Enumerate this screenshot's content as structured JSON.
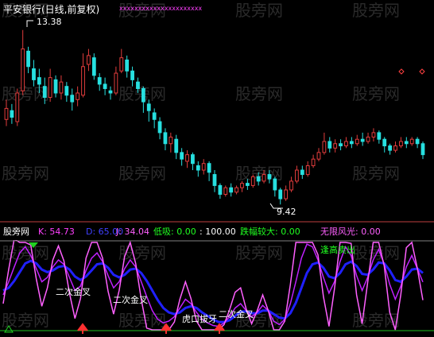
{
  "title": "平安银行(日线,前复权)",
  "watermark": "股旁网",
  "colors": {
    "background": "#000000",
    "up_candle": "#e03c3c",
    "down_candle": "#27e0e0",
    "title_text": "#ffffff",
    "k_line": "#ff40ff",
    "d_line": "#2020ff",
    "j_line": "#ff60ff",
    "diff_line": "#2a8bff",
    "baseline": "#20c020",
    "k_text": "#ff40ff",
    "d_text": "#4040ff",
    "j_text": "#ff60ff",
    "green_text": "#20ff20",
    "white_text": "#ffffff",
    "top_marks": "#ff40ff",
    "up_arrow": "#ff3030",
    "green_arrow": "#20d020"
  },
  "price_panel": {
    "high_label": "13.38",
    "low_label": "9.42",
    "top_marks": "xxxxxxxxxxxxxxxxxxxxxx"
  },
  "indicator_header": {
    "name": "股旁网",
    "k": "K: 54.73",
    "d": "D: 65.00",
    "j": "J: 34.04",
    "dixi": "低吸: 0.00",
    "level": ": 100.00",
    "diefu": "跌幅较大: 0.00",
    "wuxian": "无限风光: 0.00"
  },
  "annotations": {
    "ercijinchai1": "二次金叉",
    "ercijinchai2": "二次金叉",
    "ercijinchai3": "二次金叉",
    "hukoubayao": "虎口拔牙",
    "fenggaomaichu": "逢高卖出"
  },
  "chart_data": {
    "type": "candlestick",
    "title": "平安银行(日线,前复权)",
    "price_range": [
      9.1,
      13.7
    ],
    "high": 13.38,
    "low": 9.42,
    "candles": [
      [
        11.35,
        11.6,
        11.8,
        11.2
      ],
      [
        11.55,
        11.4,
        11.7,
        11.25
      ],
      [
        11.3,
        11.95,
        12.05,
        11.2
      ],
      [
        12.0,
        12.95,
        13.38,
        11.9
      ],
      [
        12.9,
        12.55,
        13.0,
        12.4
      ],
      [
        12.5,
        12.25,
        12.7,
        12.1
      ],
      [
        12.3,
        12.15,
        12.5,
        11.95
      ],
      [
        12.1,
        11.85,
        12.3,
        11.7
      ],
      [
        11.85,
        12.3,
        12.5,
        11.75
      ],
      [
        12.25,
        11.95,
        12.35,
        11.85
      ],
      [
        11.95,
        12.2,
        12.35,
        11.8
      ],
      [
        12.1,
        11.9,
        12.2,
        11.75
      ],
      [
        11.9,
        11.75,
        12.05,
        11.55
      ],
      [
        11.8,
        11.95,
        12.1,
        11.65
      ],
      [
        11.9,
        12.55,
        12.85,
        11.85
      ],
      [
        12.6,
        12.8,
        12.95,
        12.45
      ],
      [
        12.75,
        12.35,
        12.85,
        12.25
      ],
      [
        12.3,
        12.15,
        12.4,
        12.0
      ],
      [
        12.15,
        12.05,
        12.3,
        11.9
      ],
      [
        12.0,
        11.95,
        12.1,
        11.8
      ],
      [
        11.95,
        12.4,
        12.55,
        11.9
      ],
      [
        12.45,
        12.75,
        12.95,
        12.4
      ],
      [
        12.7,
        12.45,
        12.8,
        12.3
      ],
      [
        12.45,
        12.25,
        12.55,
        12.1
      ],
      [
        12.2,
        12.05,
        12.3,
        11.95
      ],
      [
        12.05,
        11.75,
        12.1,
        11.5
      ],
      [
        11.7,
        11.55,
        11.8,
        11.3
      ],
      [
        11.5,
        11.35,
        11.6,
        11.15
      ],
      [
        11.3,
        11.05,
        11.4,
        10.9
      ],
      [
        11.05,
        10.8,
        11.15,
        10.65
      ],
      [
        10.8,
        10.95,
        11.05,
        10.6
      ],
      [
        10.9,
        10.6,
        11.0,
        10.45
      ],
      [
        10.6,
        10.45,
        10.7,
        10.3
      ],
      [
        10.4,
        10.55,
        10.65,
        10.25
      ],
      [
        10.55,
        10.35,
        10.6,
        10.2
      ],
      [
        10.3,
        10.2,
        10.4,
        10.05
      ],
      [
        10.2,
        10.35,
        10.45,
        10.1
      ],
      [
        10.35,
        10.15,
        10.4,
        9.95
      ],
      [
        10.1,
        9.85,
        10.2,
        9.7
      ],
      [
        9.85,
        9.65,
        9.9,
        9.55
      ],
      [
        9.65,
        9.8,
        9.85,
        9.6
      ],
      [
        9.8,
        9.7,
        9.9,
        9.6
      ],
      [
        9.7,
        9.8,
        9.85,
        9.65
      ],
      [
        9.8,
        9.9,
        9.95,
        9.7
      ],
      [
        9.9,
        9.85,
        10.0,
        9.75
      ],
      [
        9.85,
        10.05,
        10.1,
        9.8
      ],
      [
        10.05,
        9.95,
        10.15,
        9.85
      ],
      [
        9.95,
        10.1,
        10.2,
        9.9
      ],
      [
        10.1,
        10.0,
        10.2,
        9.9
      ],
      [
        10.0,
        9.75,
        10.05,
        9.6
      ],
      [
        9.75,
        9.55,
        9.8,
        9.42
      ],
      [
        9.55,
        9.75,
        9.85,
        9.5
      ],
      [
        9.75,
        9.95,
        10.05,
        9.7
      ],
      [
        9.95,
        10.2,
        10.3,
        9.9
      ],
      [
        10.2,
        10.1,
        10.3,
        10.0
      ],
      [
        10.1,
        10.3,
        10.4,
        10.05
      ],
      [
        10.3,
        10.45,
        10.55,
        10.25
      ],
      [
        10.45,
        10.6,
        10.7,
        10.4
      ],
      [
        10.6,
        10.85,
        11.05,
        10.55
      ],
      [
        10.85,
        10.7,
        10.95,
        10.6
      ],
      [
        10.7,
        10.8,
        10.9,
        10.6
      ],
      [
        10.8,
        10.75,
        10.9,
        10.65
      ],
      [
        10.75,
        10.85,
        10.95,
        10.7
      ],
      [
        10.85,
        10.8,
        10.95,
        10.7
      ],
      [
        10.8,
        10.9,
        11.0,
        10.75
      ],
      [
        10.9,
        10.85,
        11.05,
        10.75
      ],
      [
        10.85,
        10.95,
        11.05,
        10.8
      ],
      [
        10.95,
        11.05,
        11.15,
        10.85
      ],
      [
        11.05,
        10.9,
        11.1,
        10.8
      ],
      [
        10.9,
        10.75,
        10.95,
        10.6
      ],
      [
        10.75,
        10.65,
        10.8,
        10.55
      ],
      [
        10.65,
        10.75,
        10.85,
        10.6
      ],
      [
        10.75,
        10.85,
        10.95,
        10.7
      ],
      [
        10.85,
        10.8,
        10.95,
        10.7
      ],
      [
        10.8,
        10.9,
        10.95,
        10.75
      ],
      [
        10.9,
        10.8,
        10.95,
        10.7
      ],
      [
        10.8,
        10.55,
        10.85,
        10.45
      ]
    ],
    "indicator": {
      "name": "股旁网",
      "range": [
        0,
        100
      ],
      "K": [
        40,
        55,
        72,
        88,
        95,
        85,
        70,
        55,
        60,
        72,
        80,
        75,
        60,
        45,
        50,
        68,
        82,
        88,
        78,
        62,
        48,
        55,
        70,
        80,
        72,
        55,
        38,
        22,
        12,
        8,
        10,
        15,
        25,
        35,
        30,
        20,
        12,
        8,
        5,
        4,
        8,
        15,
        25,
        30,
        22,
        15,
        20,
        28,
        22,
        10,
        6,
        12,
        30,
        55,
        82,
        98,
        95,
        80,
        60,
        42,
        55,
        78,
        95,
        85,
        62,
        45,
        60,
        80,
        92,
        75,
        52,
        35,
        50,
        72,
        85,
        70,
        54.73
      ],
      "D": [
        45,
        48,
        56,
        66,
        76,
        79,
        76,
        69,
        66,
        68,
        72,
        73,
        69,
        61,
        57,
        61,
        68,
        75,
        76,
        71,
        63,
        60,
        63,
        69,
        70,
        65,
        56,
        45,
        34,
        25,
        20,
        18,
        20,
        25,
        27,
        25,
        20,
        16,
        12,
        9,
        9,
        11,
        16,
        21,
        21,
        19,
        19,
        22,
        22,
        18,
        14,
        13,
        19,
        31,
        48,
        65,
        75,
        77,
        71,
        61,
        59,
        65,
        75,
        78,
        73,
        64,
        63,
        69,
        77,
        76,
        68,
        57,
        55,
        61,
        69,
        70,
        65.0
      ],
      "J": [
        30,
        69,
        104,
        100,
        100,
        97,
        58,
        27,
        48,
        80,
        96,
        79,
        42,
        13,
        36,
        82,
        100,
        100,
        82,
        44,
        18,
        45,
        84,
        100,
        76,
        35,
        2,
        0,
        0,
        0,
        0,
        9,
        35,
        55,
        36,
        10,
        0,
        0,
        0,
        0,
        6,
        23,
        43,
        48,
        24,
        7,
        22,
        40,
        22,
        0,
        0,
        10,
        52,
        100,
        100,
        100,
        100,
        86,
        38,
        4,
        47,
        100,
        100,
        99,
        40,
        7,
        54,
        100,
        100,
        73,
        20,
        0,
        40,
        94,
        100,
        70,
        34.04
      ]
    },
    "indicator_values": {
      "K": 54.73,
      "D": 65.0,
      "J": 34.04,
      "低吸": 0.0,
      "跌幅较大": 0.0,
      "无限风光": 0.0
    }
  }
}
